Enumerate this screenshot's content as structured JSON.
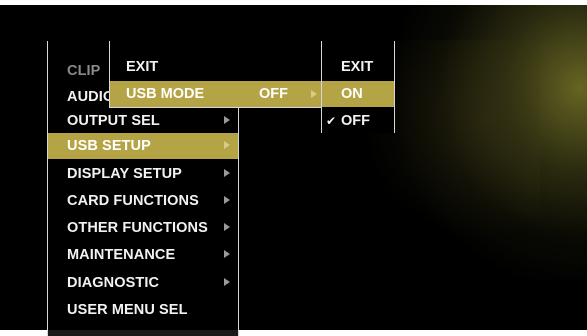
{
  "main_menu": {
    "items": [
      {
        "label": "CLIP",
        "arrow": false,
        "dim": true
      },
      {
        "label": "AUDIO",
        "arrow": false,
        "dim": false
      },
      {
        "label": "OUTPUT SEL",
        "arrow": true,
        "dim": false
      },
      {
        "label": "USB SETUP",
        "arrow": true,
        "dim": false,
        "selected": true
      },
      {
        "label": "DISPLAY SETUP",
        "arrow": true,
        "dim": false
      },
      {
        "label": "CARD FUNCTIONS",
        "arrow": true,
        "dim": false
      },
      {
        "label": "OTHER FUNCTIONS",
        "arrow": true,
        "dim": false
      },
      {
        "label": "MAINTENANCE",
        "arrow": true,
        "dim": false
      },
      {
        "label": "DIAGNOSTIC",
        "arrow": true,
        "dim": false
      },
      {
        "label": "USER MENU SEL",
        "arrow": false,
        "dim": false
      }
    ]
  },
  "sub_menu": {
    "exit_label": "EXIT",
    "usb_mode_label": "USB MODE",
    "usb_mode_value": "OFF"
  },
  "option_menu": {
    "exit_label": "EXIT",
    "on_label": "ON",
    "off_label": "OFF",
    "checked": "OFF"
  },
  "colors": {
    "highlight": "#b5a445",
    "text": "#f2f2f2",
    "dim_text": "#8a8a8a",
    "background": "#000000"
  }
}
